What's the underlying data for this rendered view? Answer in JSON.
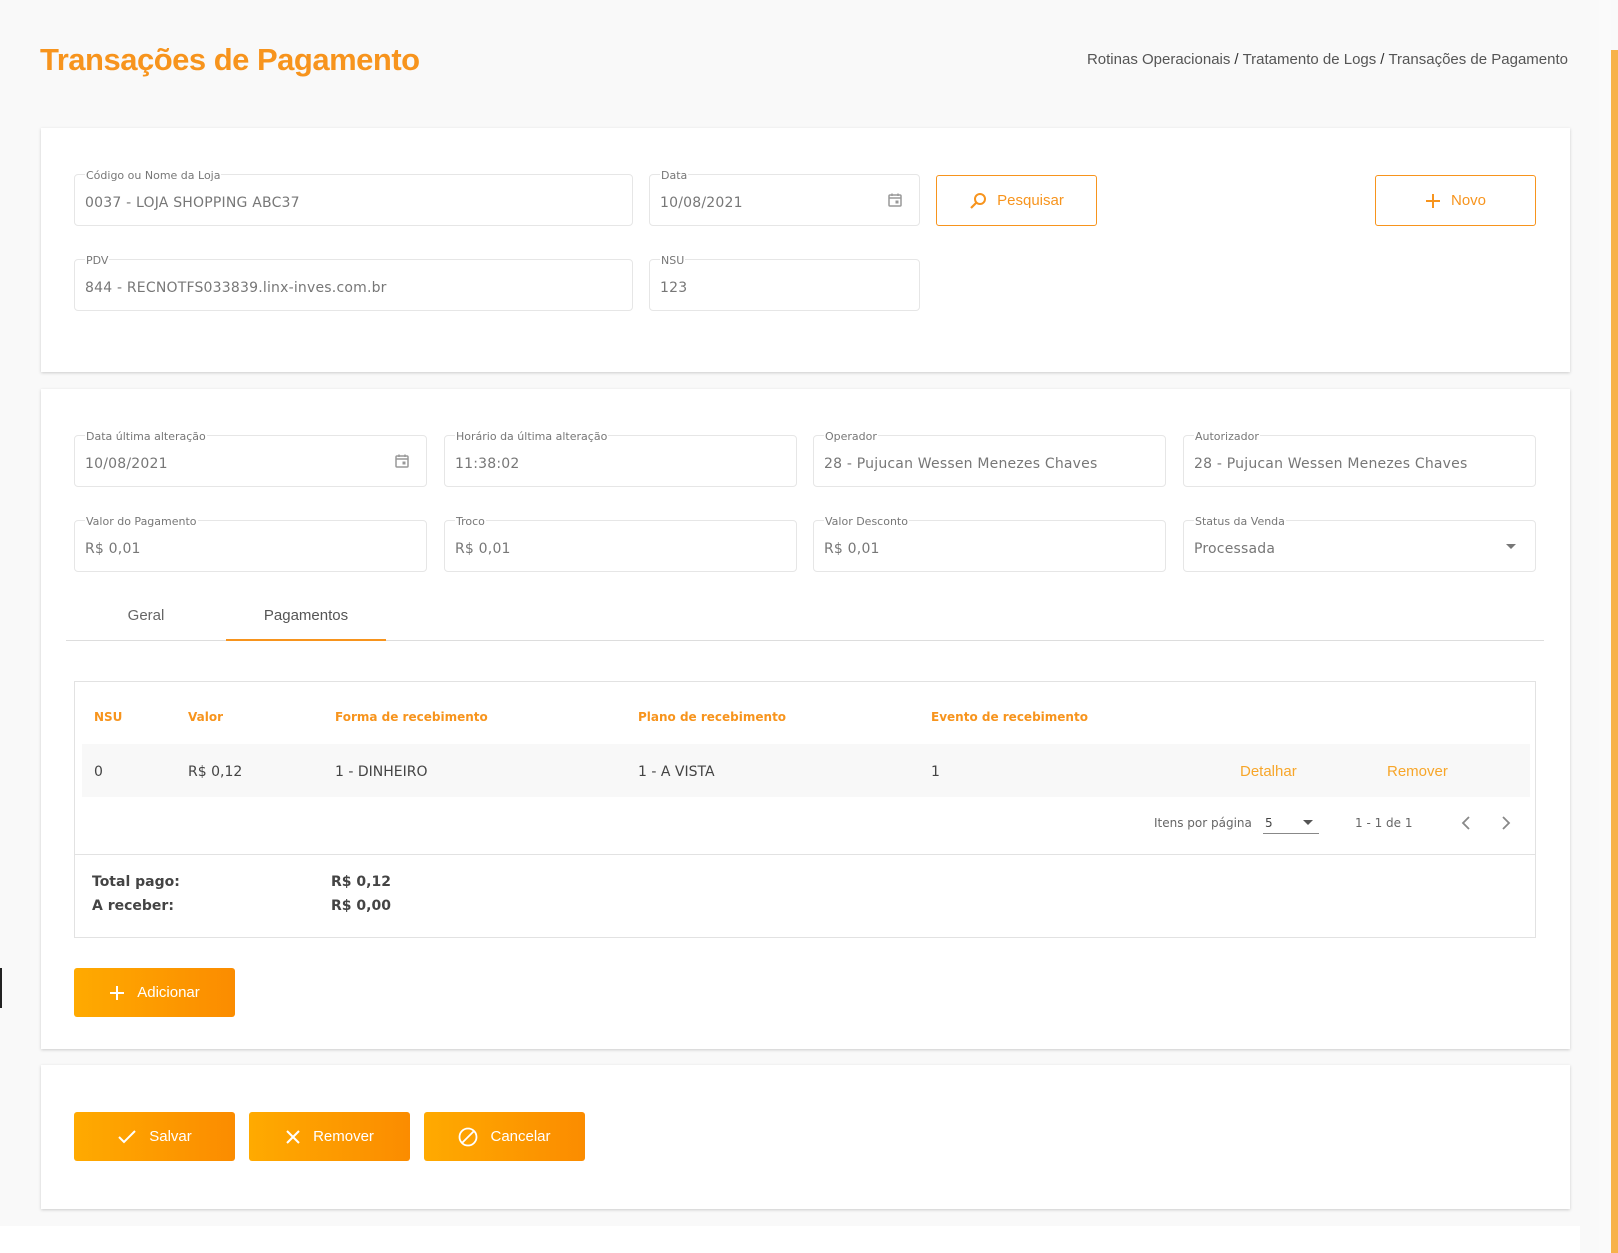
{
  "header": {
    "title": "Transações de Pagamento",
    "breadcrumb": [
      "Rotinas Operacionais",
      "Tratamento de Logs",
      "Transações de Pagamento"
    ]
  },
  "search": {
    "loja": {
      "label": "Código ou Nome da Loja",
      "value": "0037 - LOJA SHOPPING ABC37"
    },
    "data": {
      "label": "Data",
      "value": "10/08/2021"
    },
    "pdv": {
      "label": "PDV",
      "value": "844 - RECNOTFS033839.linx-inves.com.br"
    },
    "nsu": {
      "label": "NSU",
      "value": "123"
    },
    "pesquisar_label": "Pesquisar",
    "novo_label": "Novo"
  },
  "detail": {
    "data_alteracao": {
      "label": "Data última alteração",
      "value": "10/08/2021"
    },
    "horario_alteracao": {
      "label": "Horário da última alteração",
      "value": "11:38:02"
    },
    "operador": {
      "label": "Operador",
      "value": "28 - Pujucan Wessen Menezes Chaves"
    },
    "autorizador": {
      "label": "Autorizador",
      "value": "28 - Pujucan Wessen Menezes Chaves"
    },
    "valor_pagamento": {
      "label": "Valor do Pagamento",
      "value": "R$ 0,01"
    },
    "troco": {
      "label": "Troco",
      "value": "R$ 0,01"
    },
    "valor_desconto": {
      "label": "Valor Desconto",
      "value": "R$ 0,01"
    },
    "status_venda": {
      "label": "Status da Venda",
      "value": "Processada"
    }
  },
  "tabs": [
    {
      "label": "Geral",
      "active": false
    },
    {
      "label": "Pagamentos",
      "active": true
    }
  ],
  "table": {
    "columns": [
      "NSU",
      "Valor",
      "Forma de recebimento",
      "Plano de recebimento",
      "Evento de recebimento"
    ],
    "rows": [
      {
        "nsu": "0",
        "valor": "R$ 0,12",
        "forma": "1 - DINHEIRO",
        "plano": "1 - A VISTA",
        "evento": "1",
        "detalhar": "Detalhar",
        "remover": "Remover"
      }
    ],
    "pager": {
      "items_label": "Itens por página",
      "items_value": "5",
      "range": "1 - 1 de 1"
    }
  },
  "totals": {
    "pago_label": "Total pago:",
    "pago_value": "R$ 0,12",
    "receber_label": "A receber:",
    "receber_value": "R$ 0,00"
  },
  "adicionar_label": "Adicionar",
  "actions": {
    "salvar": "Salvar",
    "remover": "Remover",
    "cancelar": "Cancelar"
  },
  "colors": {
    "accent": "#f7941d",
    "button_gradient_start": "#ffaa00",
    "button_gradient_end": "#fb8c00"
  }
}
